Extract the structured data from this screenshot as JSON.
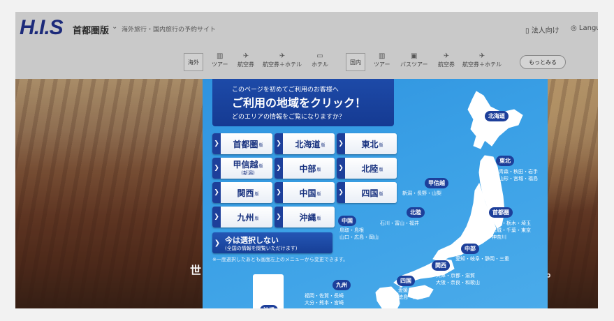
{
  "header": {
    "logo": "H.I.S",
    "region": "首都圏版",
    "tagline": "海外旅行・国内旅行の予約サイト",
    "corporate": "法人向け",
    "language": "Langu"
  },
  "nav": {
    "overseas_label": "海外",
    "overseas_items": [
      "ツアー",
      "航空券",
      "航空券＋ホテル",
      "ホテル"
    ],
    "domestic_label": "国内",
    "domestic_items": [
      "ツアー",
      "バスツアー",
      "航空券",
      "航空券＋ホテル"
    ],
    "more_label": "もっとみる"
  },
  "hero": {
    "text_left": "世",
    "text_right": "。"
  },
  "modal": {
    "line1": "このページを初めてご利用のお客様へ",
    "line2": "ご利用の地域をクリック！",
    "line3": "どのエリアの情報をご覧になりますか？",
    "edition_suffix": "版",
    "buttons": [
      {
        "label": "首都圏",
        "sub": ""
      },
      {
        "label": "北海道",
        "sub": ""
      },
      {
        "label": "東北",
        "sub": ""
      },
      {
        "label": "甲信越",
        "sub": "(新潟)"
      },
      {
        "label": "中部",
        "sub": ""
      },
      {
        "label": "北陸",
        "sub": ""
      },
      {
        "label": "関西",
        "sub": ""
      },
      {
        "label": "中国",
        "sub": ""
      },
      {
        "label": "四国",
        "sub": ""
      },
      {
        "label": "九州",
        "sub": ""
      },
      {
        "label": "沖縄",
        "sub": ""
      }
    ],
    "skip_line1": "今は選択しない",
    "skip_line2": "(全国の情報を閲覧いただけます)",
    "note": "※一度選択したあとも画面左上のメニューから変更できます。"
  },
  "map_regions": [
    {
      "name": "北海道",
      "prefs": ""
    },
    {
      "name": "東北",
      "prefs": "青森・秋田・岩手\n山形・宮城・福島"
    },
    {
      "name": "甲信越",
      "prefs": "新潟・長野・山梨"
    },
    {
      "name": "北陸",
      "prefs": "石川・富山・福井"
    },
    {
      "name": "首都圏",
      "prefs": "群馬・栃木・埼玉\n茨城・千葉・東京\n神奈川"
    },
    {
      "name": "中国",
      "prefs": "鳥取・島根\n山口・広島・岡山"
    },
    {
      "name": "中部",
      "prefs": "愛知・岐阜・静岡・三重"
    },
    {
      "name": "関西",
      "prefs": "兵庫・京都・滋賀\n大阪・奈良・和歌山"
    },
    {
      "name": "四国",
      "prefs": "愛媛・香川\n徳島・高知"
    },
    {
      "name": "九州",
      "prefs": "福岡・佐賀・長崎\n大分・熊本・宮崎"
    },
    {
      "name": "沖縄",
      "prefs": ""
    }
  ],
  "colors": {
    "brand": "#1c2a7a",
    "modal_blue": "#3aa0e6",
    "tag_navy": "#1d3f9a"
  }
}
